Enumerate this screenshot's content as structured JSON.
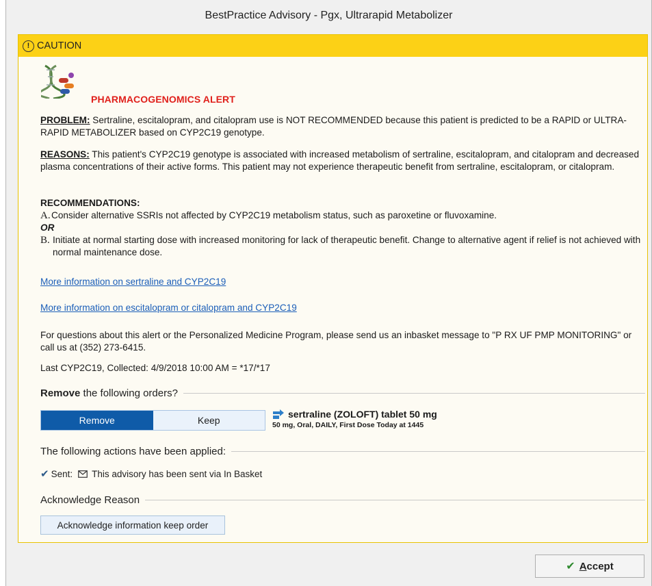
{
  "window": {
    "title": "BestPractice Advisory - Pgx, Ultrarapid Metabolizer"
  },
  "caution": {
    "label": "CAUTION",
    "icon": "exclamation-circle-icon",
    "color": "#fcd116"
  },
  "alert": {
    "title": "PHARMACOGENOMICS ALERT",
    "title_color": "#e0201b",
    "image_icon": "dna-pills-icon",
    "problem_label": "PROBLEM:",
    "problem_text": " Sertraline, escitalopram, and citalopram use is NOT RECOMMENDED because this patient is predicted to be a RAPID or ULTRA-RAPID METABOLIZER based on CYP2C19 genotype.",
    "reasons_label": "REASONS:",
    "reasons_text": " This patient's CYP2C19 genotype is associated with increased metabolism of sertraline, escitalopram, and citalopram and decreased plasma concentrations of their active forms.  This patient may not experience therapeutic benefit from sertraline, escitalopram, or citalopram.",
    "recommendations_label": "RECOMMENDATIONS:",
    "rec_a_letter": "A.",
    "rec_a_text": "Consider alternative SSRIs not affected by CYP2C19 metabolism status, such as paroxetine or fluvoxamine.",
    "or_text": "OR",
    "rec_b_letter": "B.",
    "rec_b_text": "Initiate at normal starting dose with increased monitoring for lack of therapeutic benefit. Change to alternative agent if relief is not achieved with normal maintenance dose.",
    "link_sertraline": "More information on sertraline and CYP2C19",
    "link_escitalopram": "More information on escitalopram or citalopram and CYP2C19",
    "questions_text": "For questions about this alert or the Personalized Medicine Program, please send us an inbasket message to \"P RX UF PMP MONITORING\" or call us at (352) 273-6415.",
    "last_result": "Last CYP2C19, Collected: 4/9/2018 10:00 AM = *17/*17"
  },
  "orders": {
    "heading_bold": "Remove",
    "heading_rest": " the following orders?",
    "remove_label": "Remove",
    "keep_label": "Keep",
    "selected": "Remove",
    "order_icon": "medication-order-icon",
    "order_name": "sertraline (ZOLOFT) tablet 50 mg",
    "order_detail": "50 mg, Oral, DAILY, First Dose Today at 1445"
  },
  "actions": {
    "heading": "The following actions have been applied:",
    "sent_label": "Sent:",
    "sent_text": "This advisory has been sent via In Basket"
  },
  "acknowledge": {
    "heading": "Acknowledge Reason",
    "button_label": "Acknowledge information keep order"
  },
  "footer": {
    "accept_prefix": "",
    "accept_underlined": "A",
    "accept_rest": "ccept"
  },
  "colors": {
    "accent": "#0f5ba8",
    "link": "#1b5eb8",
    "panel_border": "#e8c200"
  }
}
